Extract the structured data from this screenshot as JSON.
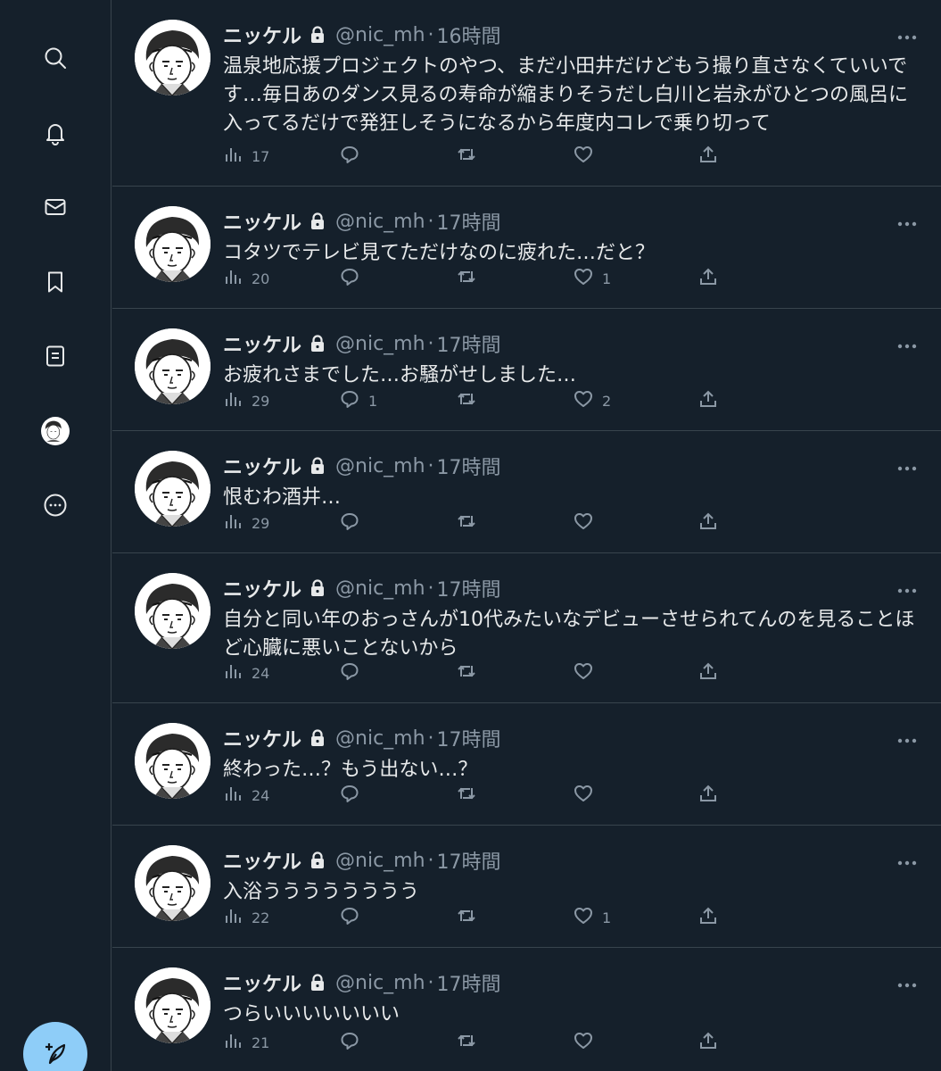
{
  "sidebar": {
    "items": [
      {
        "name": "search-icon"
      },
      {
        "name": "bell-icon"
      },
      {
        "name": "mail-icon"
      },
      {
        "name": "bookmark-icon"
      },
      {
        "name": "list-icon"
      },
      {
        "name": "profile-avatar"
      },
      {
        "name": "more-circle-icon"
      }
    ],
    "compose_icon": "feather-plus-icon"
  },
  "colors": {
    "background": "#15202b",
    "border": "#38444d",
    "text": "#e7e9ea",
    "muted": "#8b98a5",
    "compose": "#8ecdf8"
  },
  "tweets": [
    {
      "name": "ニッケル",
      "handle": "@nic_mh",
      "dot": "·",
      "time": "16時間",
      "text": "温泉地応援プロジェクトのやつ、まだ小田井だけどもう撮り直さなくていいです…毎日あのダンス見るの寿命が縮まりそうだし白川と岩永がひとつの風呂に入ってるだけで発狂しそうになるから年度内コレで乗り切って",
      "views": "17",
      "replies": "",
      "retweets": "",
      "likes": ""
    },
    {
      "name": "ニッケル",
      "handle": "@nic_mh",
      "dot": "·",
      "time": "17時間",
      "text": "コタツでテレビ見てただけなのに疲れた…だと？",
      "views": "20",
      "replies": "",
      "retweets": "",
      "likes": "1"
    },
    {
      "name": "ニッケル",
      "handle": "@nic_mh",
      "dot": "·",
      "time": "17時間",
      "text": "お疲れさまでした…お騒がせしました…",
      "views": "29",
      "replies": "1",
      "retweets": "",
      "likes": "2"
    },
    {
      "name": "ニッケル",
      "handle": "@nic_mh",
      "dot": "·",
      "time": "17時間",
      "text": "恨むわ酒井…",
      "views": "29",
      "replies": "",
      "retweets": "",
      "likes": ""
    },
    {
      "name": "ニッケル",
      "handle": "@nic_mh",
      "dot": "·",
      "time": "17時間",
      "text": "自分と同い年のおっさんが10代みたいなデビューさせられてんのを見ることほど心臓に悪いことないから",
      "views": "24",
      "replies": "",
      "retweets": "",
      "likes": ""
    },
    {
      "name": "ニッケル",
      "handle": "@nic_mh",
      "dot": "·",
      "time": "17時間",
      "text": "終わった…？もう出ない…？",
      "views": "24",
      "replies": "",
      "retweets": "",
      "likes": ""
    },
    {
      "name": "ニッケル",
      "handle": "@nic_mh",
      "dot": "·",
      "time": "17時間",
      "text": "入浴うううううううう",
      "views": "22",
      "replies": "",
      "retweets": "",
      "likes": "1"
    },
    {
      "name": "ニッケル",
      "handle": "@nic_mh",
      "dot": "·",
      "time": "17時間",
      "text": "つらいいいいいいい",
      "views": "21",
      "replies": "",
      "retweets": "",
      "likes": ""
    }
  ]
}
